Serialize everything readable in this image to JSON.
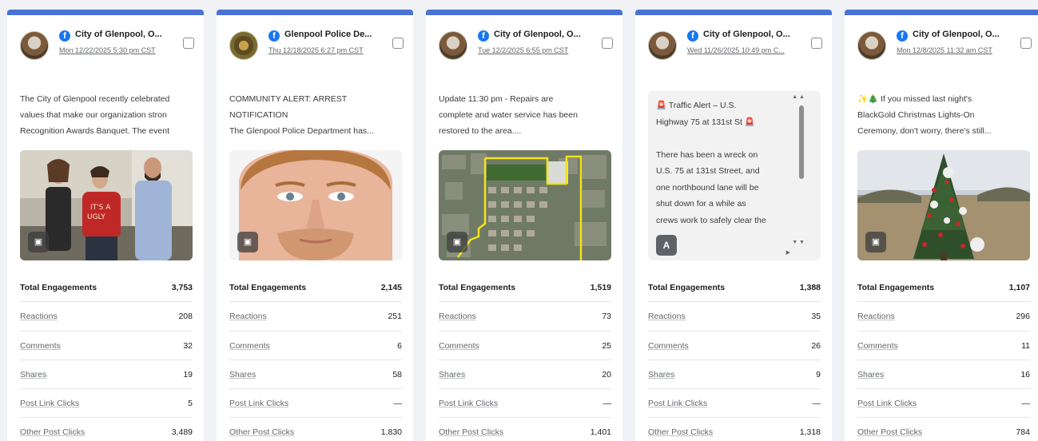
{
  "cards": [
    {
      "page_name": "City of Glenpool, O...",
      "date": "Mon 12/22/2025 5:30 pm CST",
      "avatar": "city-seal",
      "text": "The City of Glenpool recently celebrated\nvalues that make our organization stron\nRecognition Awards Banquet. The event",
      "media": "photo-three-people",
      "metrics": {
        "total_label": "Total Engagements",
        "total": "3,753",
        "reactions_label": "Reactions",
        "reactions": "208",
        "comments_label": "Comments",
        "comments": "32",
        "shares_label": "Shares",
        "shares": "19",
        "link_clicks_label": "Post Link Clicks",
        "link_clicks": "5",
        "other_clicks_label": "Other Post Clicks",
        "other_clicks": "3,489"
      }
    },
    {
      "page_name": "Glenpool Police De...",
      "date": "Thu 12/18/2025 6:27 pm CST",
      "avatar": "police-badge",
      "text": "COMMUNITY ALERT: ARREST\nNOTIFICATION\nThe Glenpool Police Department has...",
      "media": "photo-mugshot",
      "metrics": {
        "total_label": "Total Engagements",
        "total": "2,145",
        "reactions_label": "Reactions",
        "reactions": "251",
        "comments_label": "Comments",
        "comments": "6",
        "shares_label": "Shares",
        "shares": "58",
        "link_clicks_label": "Post Link Clicks",
        "link_clicks": "—",
        "other_clicks_label": "Other Post Clicks",
        "other_clicks": "1,830"
      }
    },
    {
      "page_name": "City of Glenpool, O...",
      "date": "Tue 12/2/2025 6:55 pm CST",
      "avatar": "city-seal",
      "text": "Update 11:30 pm - Repairs are\ncomplete and water service has been\nrestored to the area....",
      "media": "photo-aerial-map",
      "metrics": {
        "total_label": "Total Engagements",
        "total": "1,519",
        "reactions_label": "Reactions",
        "reactions": "73",
        "comments_label": "Comments",
        "comments": "25",
        "shares_label": "Shares",
        "shares": "20",
        "link_clicks_label": "Post Link Clicks",
        "link_clicks": "—",
        "other_clicks_label": "Other Post Clicks",
        "other_clicks": "1,401"
      }
    },
    {
      "page_name": "City of Glenpool, O...",
      "date": "Wed 11/26/2025 10:49 pm C...",
      "avatar": "city-seal",
      "text_card": "🚨 Traffic Alert – U.S.\nHighway 75 at 131st St 🚨\n\nThere has been a wreck on\nU.S. 75 at 131st Street, and\none northbound lane will be\nshut down for a while as\ncrews work to safely clear the",
      "metrics": {
        "total_label": "Total Engagements",
        "total": "1,388",
        "reactions_label": "Reactions",
        "reactions": "35",
        "comments_label": "Comments",
        "comments": "26",
        "shares_label": "Shares",
        "shares": "9",
        "link_clicks_label": "Post Link Clicks",
        "link_clicks": "—",
        "other_clicks_label": "Other Post Clicks",
        "other_clicks": "1,318"
      }
    },
    {
      "page_name": "City of Glenpool, O...",
      "date": "Mon 12/8/2025 11:32 am CST",
      "avatar": "city-seal",
      "text": "✨🎄 If you missed last night's\nBlackGold Christmas Lights-On\nCeremony, don't worry, there's still...",
      "media": "photo-christmas-tree",
      "metrics": {
        "total_label": "Total Engagements",
        "total": "1,107",
        "reactions_label": "Reactions",
        "reactions": "296",
        "comments_label": "Comments",
        "comments": "11",
        "shares_label": "Shares",
        "shares": "16",
        "link_clicks_label": "Post Link Clicks",
        "link_clicks": "—",
        "other_clicks_label": "Other Post Clicks",
        "other_clicks": "784"
      }
    }
  ],
  "colors": {
    "accent": "#4a72d6",
    "facebook": "#1877f2",
    "background": "#f0f2f5"
  },
  "icons": {
    "facebook": "facebook-icon",
    "media_badge": "image-icon",
    "text_badge": "text-post-icon"
  }
}
